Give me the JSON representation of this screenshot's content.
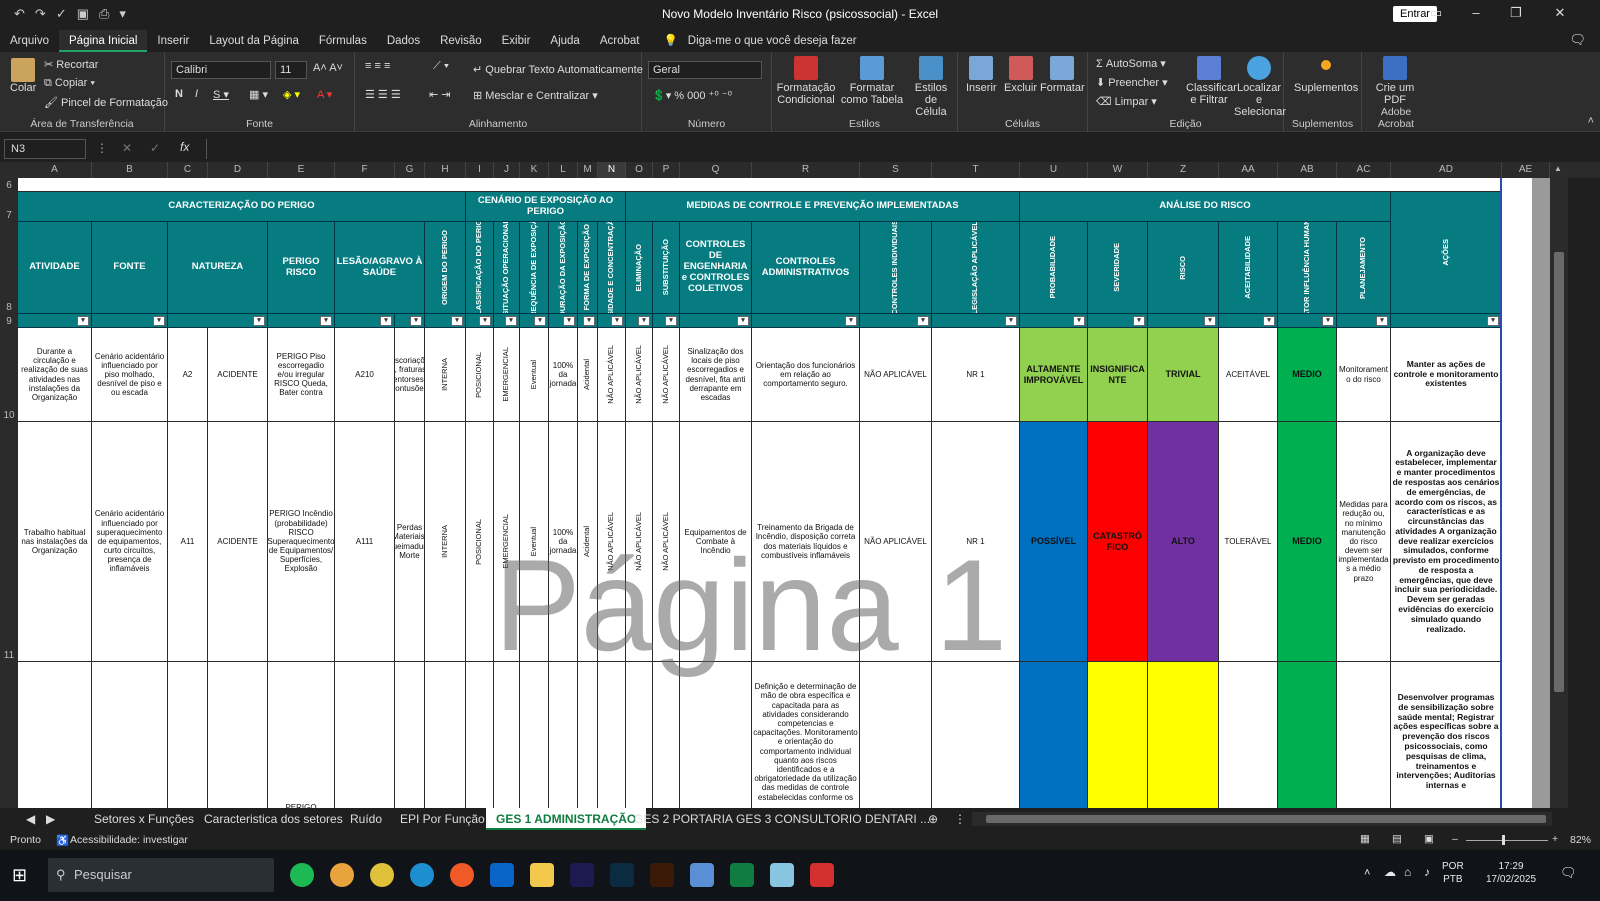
{
  "titlebar": {
    "title": "Novo Modelo Inventário Risco (psicossocial)  -  Excel",
    "enter": "Entrar"
  },
  "menu": [
    "Arquivo",
    "Página Inicial",
    "Inserir",
    "Layout da Página",
    "Fórmulas",
    "Dados",
    "Revisão",
    "Exibir",
    "Ajuda",
    "Acrobat"
  ],
  "tellme": "Diga-me o que você deseja fazer",
  "ribbon": {
    "clipboard": {
      "paste": "Colar",
      "cut": "Recortar",
      "copy": "Copiar",
      "painter": "Pincel de Formatação",
      "label": "Área de Transferência"
    },
    "font": {
      "name": "Calibri",
      "size": "11",
      "label": "Fonte"
    },
    "align": {
      "wrap": "Quebrar Texto Automaticamente",
      "merge": "Mesclar e Centralizar",
      "label": "Alinhamento"
    },
    "number": {
      "format": "Geral",
      "label": "Número"
    },
    "styles": {
      "cond": "Formatação Condicional",
      "table": "Formatar como Tabela",
      "cell": "Estilos de Célula",
      "label": "Estilos"
    },
    "cells": {
      "insert": "Inserir",
      "delete": "Excluir",
      "format": "Formatar",
      "label": "Células"
    },
    "editing": {
      "autosum": "AutoSoma",
      "fill": "Preencher",
      "clear": "Limpar",
      "sort": "Classificar e Filtrar",
      "find": "Localizar e Selecionar",
      "label": "Edição"
    },
    "addins": {
      "label1": "Suplementos",
      "label2": "Suplementos"
    },
    "acrobat": {
      "btn": "Crie um PDF",
      "label": "Adobe Acrobat"
    }
  },
  "namebox": "N3",
  "columns": [
    "A",
    "B",
    "C",
    "D",
    "E",
    "F",
    "G",
    "H",
    "I",
    "J",
    "K",
    "L",
    "M",
    "N",
    "O",
    "P",
    "Q",
    "R",
    "S",
    "T",
    "U",
    "W",
    "Z",
    "AA",
    "AB",
    "AC",
    "AD",
    "AE"
  ],
  "rows": [
    "6",
    "7",
    "8",
    "9",
    "10",
    "11"
  ],
  "headers": {
    "caracterizacao": "CARACTERIZAÇÃO DO PERIGO",
    "cenario": "CENÁRIO DE EXPOSIÇÃO AO PERIGO",
    "medidas": "MEDIDAS DE CONTROLE E PREVENÇÃO IMPLEMENTADAS",
    "analise": "ANÁLISE  DO RISCO",
    "atividade": "ATIVIDADE",
    "fonte": "FONTE",
    "natureza": "NATUREZA",
    "perigo": "PERIGO RISCO",
    "lesao": "LESÃO/AGRAVO À SAÚDE",
    "origem": "ORIGEM DO PERIGO",
    "classif": "CLASSIFICAÇÃO DO PERIGO",
    "situacao": "SITUAÇÃO OPERACIONAL",
    "frequencia": "FREQUÊNCIA DE EXPOSIÇÃO",
    "duracao": "DURAÇÃO DA EXPOSIÇÃO",
    "forma": "FORMA DE EXPOSIÇÃO",
    "intensidade": "INTENSIDADE E CONCENTRAÇÃO NEN",
    "eliminacao": "ELIMINAÇÃO",
    "substituicao": "SUBSTITUIÇÃO",
    "engenharia": "CONTROLES DE ENGENHARIA e CONTROLES COLETIVOS",
    "administrativos": "CONTROLES ADMINISTRATIVOS",
    "individuais": "CONTROLES INDIVIDUAIS",
    "legislacao": "LEGISLAÇÃO APLICÁVEL",
    "probabilidade": "PROBABILIDADE",
    "severidade": "SEVERIDADE",
    "risco": "RISCO",
    "aceitabilidade": "ACEITABILIDADE",
    "fator": "FATOR INFLUÊNCIA HUMANA",
    "planejamento": "PLANEJAMENTO",
    "acoes": "AÇÕES"
  },
  "row10": {
    "atividade": "Durante a circulação e realização de suas atividades nas instalações da Organização",
    "fonte": "Cenário acidentário influenciado por piso molhado, desnível de piso e ou escada",
    "natureza_c": "A2",
    "natureza_d": "ACIDENTE",
    "perigo": "PERIGO Piso escorregadio e/ou irregular RISCO Queda, Bater contra",
    "lesao_f": "A210",
    "lesao_g": "Escoriaçõe s, fraturas, entorses, contusões",
    "origem": "INTERNA",
    "classif": "POSICIONAL",
    "situacao": "EMERGENCIAL",
    "frequencia": "Eventual",
    "duracao": "100% da jornada",
    "forma": "Acidental",
    "intensidade": "NÃO APLICÁVEL",
    "eliminacao": "NÃO APLICÁVEL",
    "substituicao": "NÃO APLICÁVEL",
    "engenharia": "Sinalização dos locais de piso escorregadios e desnível, fita anti derrapante em escadas",
    "administrativos": "Orientação dos funcionários em relação ao comportamento seguro.",
    "individuais": "NÃO APLICÁVEL",
    "legislacao": "NR 1",
    "probabilidade": "ALTAMENTE IMPROVÁVEL",
    "severidade": "INSIGNIFICA NTE",
    "risco": "TRIVIAL",
    "aceitabilidade": "ACEITÁVEL",
    "fator": "MEDIO",
    "planejamento": "Monitorament o do risco",
    "acoes": "Manter as ações de controle e monitoramento existentes"
  },
  "row11": {
    "atividade": "Trabalho habitual nas instalações da Organização",
    "fonte": "Cenário acidentário influenciado por superaquecimento de equipamentos, curto circuitos, presença de inflamáveis",
    "natureza_c": "A11",
    "natureza_d": "ACIDENTE",
    "perigo": "PERIGO Incêndio (probabilidade) RISCO Superaquecimento de Equipamentos/ Superfícies, Explosão",
    "lesao_f": "A111",
    "lesao_g": "Perdas Materiais, Queimadura, Morte",
    "origem": "INTERNA",
    "classif": "POSICIONAL",
    "situacao": "EMERGENCIAL",
    "frequencia": "Eventual",
    "duracao": "100% da jornada",
    "forma": "Acidental",
    "intensidade": "NÃO APLICÁVEL",
    "eliminacao": "NÃO APLICÁVEL",
    "substituicao": "NÃO APLICÁVEL",
    "engenharia": "Equipamentos de Combate à Incêndio",
    "administrativos": "Treinamento da Brigada de Incêndio, disposição correta dos materiais líquidos e combustíveis inflamáveis",
    "individuais": "NÃO APLICÁVEL",
    "legislacao": "NR 1",
    "probabilidade": "POSSÍVEL",
    "severidade": "CATASTRÓ FICO",
    "risco": "ALTO",
    "aceitabilidade": "TOLERÁVEL",
    "fator": "MEDIO",
    "planejamento": "Medidas para redução ou, no mínimo manutenção do risco devem ser implementada s a médio prazo",
    "acoes": "A organização deve estabelecer, implementar e manter procedimentos de respostas aos cenários de emergências, de acordo com os riscos, as características e as circunstâncias das atividades  A organização deve realizar exercícios simulados, conforme previsto em procedimento de resposta a emergências, que deve incluir sua periodicidade. Devem ser geradas evidências do exercício simulado quando realizado."
  },
  "row12": {
    "perigo": "PERIGO Exigência de alto",
    "administrativos": "Definição e determinação de mão de obra específica e capacitada para as atividades considerando competencias e capacitações. Monitoramento e orientação do comportamento individual quanto aos riscos identificados e a obrigatoriedade da utilização das medidas de controle estabelecidas conforme os",
    "acoes": "Desenvolver programas de sensibilização sobre saúde mental; Registrar ações específicas sobre a prevenção dos riscos psicossociais, como pesquisas de clima, treinamentos e intervenções; Auditorias internas e"
  },
  "colors": {
    "header": "#077c80",
    "green": "#92d050",
    "darkgreen": "#00b050",
    "blue": "#0070c0",
    "red": "#ff0000",
    "purple": "#7030a0",
    "yellow": "#ffff00"
  },
  "watermark": "Página 1",
  "tabs": [
    "Setores x Funções",
    "Caracteristica dos setores",
    "Ruído",
    "EPI Por Função",
    "GES 1 ADMINISTRAÇÃO",
    "GES 2 PORTARIA",
    "GES 3 CONSULTORIO DENTARI ..."
  ],
  "status": {
    "ready": "Pronto",
    "access": "Acessibilidade: investigar",
    "zoom": "82%"
  },
  "taskbar": {
    "search": "Pesquisar",
    "lang1": "POR",
    "lang2": "PTB",
    "time": "17:29",
    "date": "17/02/2025"
  }
}
